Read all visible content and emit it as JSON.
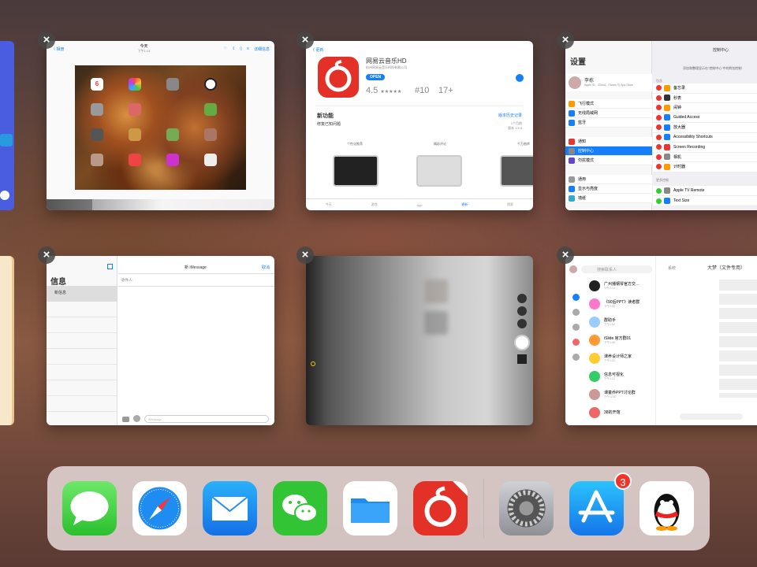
{
  "switcher": {
    "close_glyph": "×",
    "photos_card": {
      "back": "〈 相册",
      "title": "今天",
      "subtitle": "下午1:13",
      "edit": "详细信息",
      "clock_time": "6"
    },
    "appstore_card": {
      "back": "〈 更新",
      "app_name": "网易云音乐HD",
      "developer": "杭州网易云音乐科技有限公司",
      "open": "OPEN",
      "rating": "4.5",
      "stars": "★★★★★",
      "rank": "#10",
      "age": "17+",
      "new_features": "新功能",
      "version_history": "版本历史记录",
      "fix_note": "修复已知问题",
      "date": "1个月前",
      "version": "版本 1.9.3",
      "shot1": "个性化推荐",
      "shot2": "精彩评论",
      "shot3": "千万曲库",
      "tabs": [
        "今天",
        "游戏",
        "App",
        "更新",
        "搜索"
      ]
    },
    "settings_card": {
      "title": "设置",
      "user_name": "李栋",
      "user_sub": "Apple ID、iCloud、iTunes 与 App Store",
      "rows": [
        "飞行模式",
        "无线局域网",
        "蓝牙",
        "通知",
        "控制中心",
        "勿扰模式",
        "通用",
        "显示与亮度",
        "墙纸"
      ],
      "wifi_value": "TP-LINK_5963",
      "bt_value": "打开",
      "cc_title": "控制中心",
      "cc_desc": "添加和整理显示在“控制中心”中的附加控制",
      "include": "包含",
      "included": [
        "备忘录",
        "秒表",
        "闹钟",
        "Guided Access",
        "放大器",
        "Accessibility Shortcuts",
        "Screen Recording",
        "相机",
        "计时器"
      ],
      "more": "更多控制",
      "more_items": [
        "Apple TV Remote",
        "Text Size"
      ]
    },
    "messages_card": {
      "title": "信息",
      "new_msg": "新信息",
      "header": "新 iMessage",
      "cancel": "取消",
      "to": "收件人：",
      "placeholder": "iMessage"
    },
    "qq_card": {
      "search": "搜索联系人",
      "chats": [
        {
          "name": "广州播钢琴官方交…",
          "time": "下午2:14"
        },
        {
          "name": "《90后PPT》读者群",
          "time": "下午2:05"
        },
        {
          "name": "群助手",
          "time": "下午1:52"
        },
        {
          "name": "iSlide 官方群01",
          "time": "下午1:48"
        },
        {
          "name": "课养设计师之家",
          "time": "下午1:33"
        },
        {
          "name": "信息可视化",
          "time": "下午1:12"
        },
        {
          "name": "课童乔PPT讨论群",
          "time": "下午12:57"
        },
        {
          "name": "38的开馆",
          "time": ""
        }
      ],
      "right_title": "大梦（文件专用）",
      "right_back": "系统"
    }
  },
  "dock": {
    "apps": [
      "Messages",
      "Safari",
      "Mail",
      "WeChat",
      "Files",
      "NetEase Cloud Music HD",
      "Settings",
      "App Store",
      "QQ"
    ],
    "appstore_badge": "3"
  }
}
